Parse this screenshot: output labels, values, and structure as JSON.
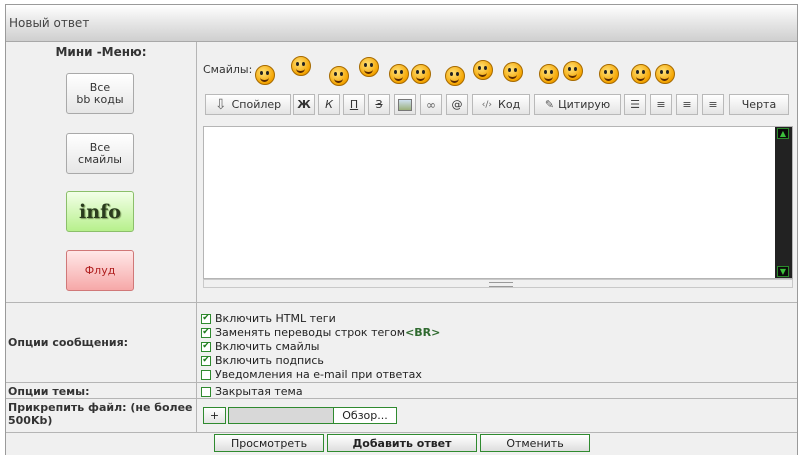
{
  "title": "Новый ответ",
  "mini_menu": {
    "title": "Мини -Меню:",
    "all_bbcodes": "Все\nbb коды",
    "all_smilies": "Все\nсмайлы",
    "info": "info",
    "flood": "Флуд"
  },
  "smilies": {
    "label": "Смайлы:",
    "icons": [
      "smile-icon",
      "angry-icon",
      "wink-icon",
      "crazy-icon",
      "grin-icon",
      "laugh-icon",
      "think-icon",
      "happy-icon",
      "devil-icon",
      "shock-icon",
      "teeth-icon",
      "scared-icon",
      "hug-icon",
      "smile2-icon"
    ]
  },
  "toolbar": {
    "spoiler": "Спойлер",
    "bold": "Ж",
    "italic": "К",
    "underline": "П",
    "strike": "З",
    "image_icon": "image-icon",
    "link_icon": "link-icon",
    "email": "@",
    "code": "Код",
    "quote": "Цитирую",
    "list_icon": "list-icon",
    "align_left_icon": "align-left-icon",
    "align_center_icon": "align-center-icon",
    "align_right_icon": "align-right-icon",
    "line": "Черта"
  },
  "options": {
    "label": "Опции сообщения:",
    "items": [
      {
        "text": "Включить HTML теги",
        "checked": true,
        "suffix": ""
      },
      {
        "text": "Заменять переводы строк тегом ",
        "checked": true,
        "suffix": "<BR>"
      },
      {
        "text": "Включить смайлы",
        "checked": true,
        "suffix": ""
      },
      {
        "text": "Включить подпись",
        "checked": true,
        "suffix": ""
      },
      {
        "text": "Уведомления на e-mail при ответах",
        "checked": false,
        "suffix": ""
      }
    ]
  },
  "topic_options": {
    "label": "Опции темы:",
    "closed": "Закрытая тема"
  },
  "attach": {
    "label": "Прикрепить файл: (не более 500Kb)",
    "add": "+",
    "browse": "Обзор..."
  },
  "actions": {
    "preview": "Просмотреть",
    "submit": "Добавить ответ",
    "cancel": "Отменить"
  },
  "colors": {
    "accent_green": "#2f8a2f",
    "info_green": "#b7f08c",
    "flood_red": "#f6a8a8"
  }
}
